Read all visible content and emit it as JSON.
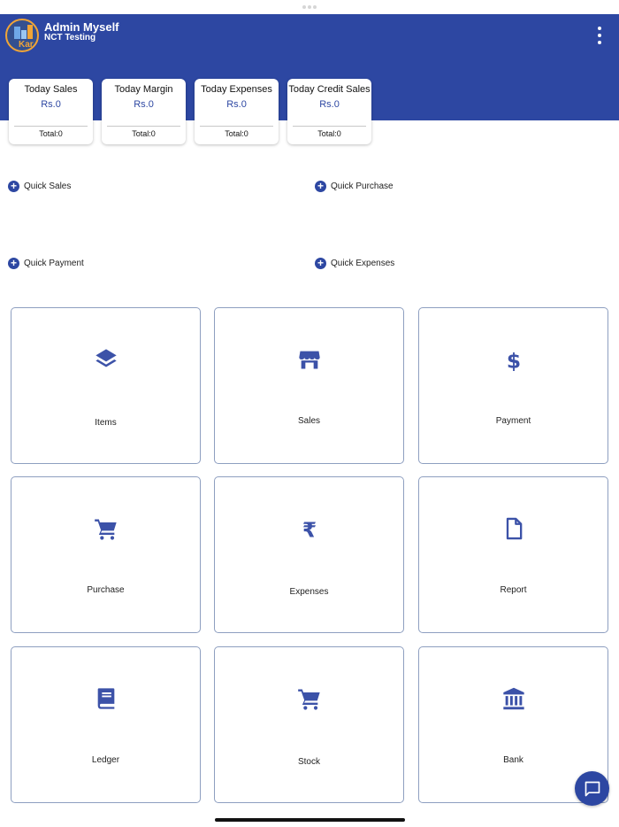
{
  "header": {
    "user_name": "Admin Myself",
    "org_name": "NCT Testing",
    "logo_text": "Kar",
    "background_color": "#2d47a2"
  },
  "stats": [
    {
      "title": "Today Sales",
      "value": "Rs.0",
      "total": "Total:0"
    },
    {
      "title": "Today Margin",
      "value": "Rs.0",
      "total": "Total:0"
    },
    {
      "title": "Today Expenses",
      "value": "Rs.0",
      "total": "Total:0"
    },
    {
      "title": "Today Credit Sales",
      "value": "Rs.0",
      "total": "Total:0"
    }
  ],
  "quick_actions": [
    {
      "label": "Quick Sales",
      "icon": "plus-circle-icon"
    },
    {
      "label": "Quick Purchase",
      "icon": "plus-circle-icon"
    },
    {
      "label": "Quick Payment",
      "icon": "plus-circle-icon"
    },
    {
      "label": "Quick Expenses",
      "icon": "plus-circle-icon"
    }
  ],
  "tiles": [
    {
      "label": "Items",
      "icon": "layers-icon"
    },
    {
      "label": "Sales",
      "icon": "store-icon"
    },
    {
      "label": "Payment",
      "icon": "dollar-icon"
    },
    {
      "label": "Purchase",
      "icon": "cart-icon"
    },
    {
      "label": "Expenses",
      "icon": "rupee-icon"
    },
    {
      "label": "Report",
      "icon": "file-icon"
    },
    {
      "label": "Ledger",
      "icon": "book-icon"
    },
    {
      "label": "Stock",
      "icon": "cart-icon"
    },
    {
      "label": "Bank",
      "icon": "bank-icon"
    }
  ],
  "icon_color": "#3c52a8",
  "chat_icon": "chat-icon"
}
